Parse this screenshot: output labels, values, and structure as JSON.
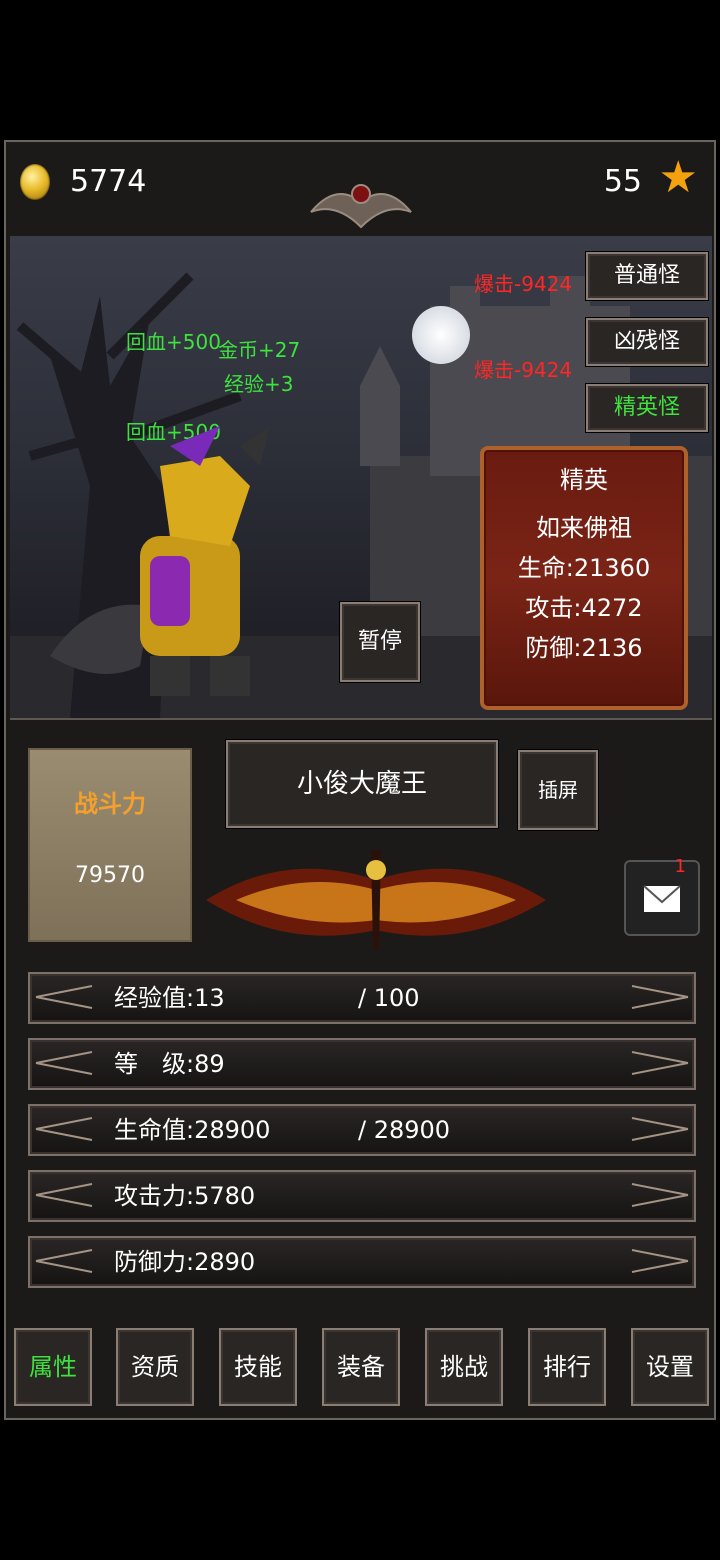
{
  "topbar": {
    "gold": "5774",
    "level": "55"
  },
  "scene": {
    "floats": {
      "heal1": "回血+500",
      "heal2": "回血+500",
      "gold_gain": "金币+27",
      "exp_gain": "经验+3",
      "crit1": "爆击-9424",
      "crit2": "爆击-9424"
    },
    "monster_buttons": [
      "普通怪",
      "凶残怪",
      "精英怪"
    ],
    "enemy": {
      "tier": "精英",
      "name": "如来佛祖",
      "hp": "生命:21360",
      "atk": "攻击:4272",
      "def": "防御:2136"
    },
    "pause_label": "暂停"
  },
  "player": {
    "power_label": "战斗力",
    "power_value": "79570",
    "name": "小俊大魔王",
    "insert_label": "插屏",
    "mail_badge": "1"
  },
  "stats": {
    "exp": {
      "label": "经验值:13",
      "max": "/ 100"
    },
    "level": {
      "label": "等　级:89"
    },
    "hp": {
      "label": "生命值:28900",
      "max": "/ 28900"
    },
    "atk": {
      "label": "攻击力:5780"
    },
    "def": {
      "label": "防御力:2890"
    }
  },
  "nav": [
    "属性",
    "资质",
    "技能",
    "装备",
    "挑战",
    "排行",
    "设置"
  ],
  "colors": {
    "accent_green": "#3ee23e",
    "damage_red": "#ff2626",
    "power_orange": "#f6a02c",
    "star": "#f3a20d"
  }
}
